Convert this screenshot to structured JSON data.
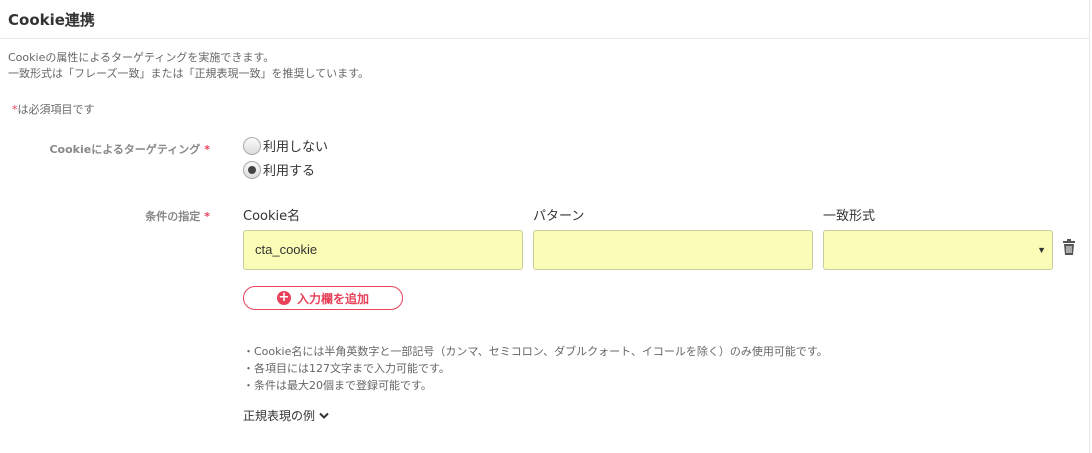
{
  "section": {
    "title": "Cookie連携",
    "description_line1": "Cookieの属性によるターゲティングを実施できます。",
    "description_line2": "一致形式は「フレーズ一致」または「正規表現一致」を推奨しています。",
    "required_star": "*",
    "required_note": "は必須項目です"
  },
  "targeting": {
    "label": "Cookieによるターゲティング",
    "star": "*",
    "options": [
      {
        "label": "利用しない",
        "checked": false
      },
      {
        "label": "利用する",
        "checked": true
      }
    ]
  },
  "conditions": {
    "label": "条件の指定",
    "star": "*",
    "columns": [
      "Cookie名",
      "パターン",
      "一致形式"
    ],
    "rows": [
      {
        "cookie_name": "cta_cookie",
        "pattern": "",
        "match_type": ""
      }
    ],
    "add_button_label": "入力欄を追加",
    "notes": [
      "・Cookie名には半角英数字と一部記号（カンマ、セミコロン、ダブルクォート、イコールを除く）のみ使用可能です。",
      "・各項目には127文字まで入力可能です。",
      "・条件は最大20個まで登録可能です。"
    ],
    "regex_example_label": "正規表現の例"
  },
  "icons": {
    "select_arrow": "caret-down-icon",
    "delete": "trash-icon",
    "add": "plus-circle-icon",
    "expand": "chevron-down-icon"
  },
  "colors": {
    "accent": "#e8425b",
    "input_bg": "#fbfdb6"
  }
}
